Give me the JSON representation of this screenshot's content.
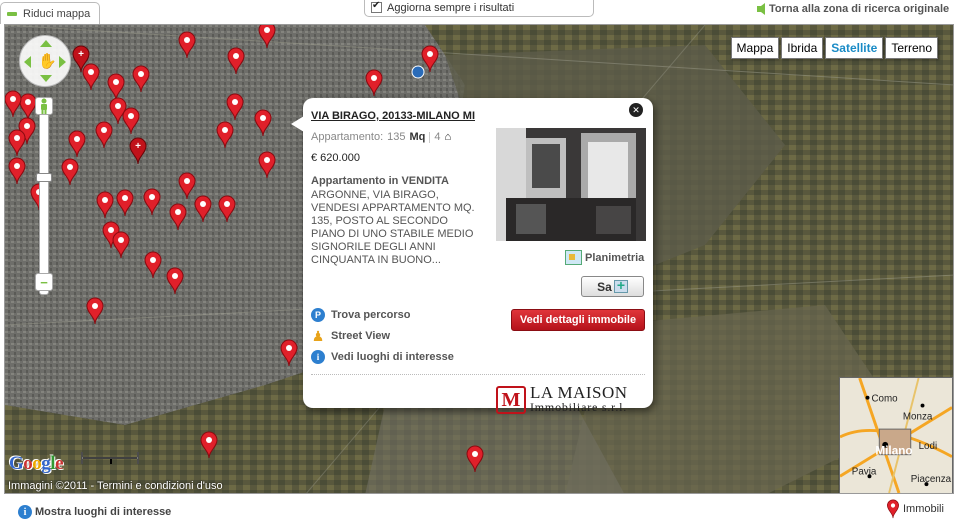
{
  "top": {
    "reduce_label": "Riduci mappa",
    "update_label": "Aggiorna sempre i risultati",
    "update_checked": true,
    "back_label": "Torna alla zona di ricerca originale"
  },
  "map": {
    "types": [
      "Mappa",
      "Ibrida",
      "Satellite",
      "Terreno"
    ],
    "active_type": "Satellite",
    "copyright": "Immagini ©2011 - Termini e condizioni d'uso",
    "google_logo": "Google",
    "overview_labels": [
      "Como",
      "Monza",
      "Milano",
      "Lodi",
      "Pavia",
      "Piacenza"
    ]
  },
  "popup": {
    "address": "VIA BIRAGO, 20133-MILANO MI",
    "type_label": "Appartamento:",
    "size_value": "135",
    "size_unit": "Mq",
    "rooms": "4",
    "price": "€ 620.000",
    "contract": "Appartamento in VENDITA",
    "description": "ARGONNE, VIA BIRAGO, VENDESI APPARTAMENTO MQ. 135, POSTO AL SECONDO PIANO DI UNO STABILE MEDIO SIGNORILE DEGLI ANNI CINQUANTA IN BUONO...",
    "planimetria": "Planimetria",
    "save_label": "Sa",
    "details_label": "Vedi dettagli immobile",
    "actions": [
      "Trova percorso",
      "Street View",
      "Vedi luoghi di interesse"
    ],
    "agency_line1": "LA MAISON",
    "agency_line2": "Immobiliare s.r.l."
  },
  "bottom": {
    "interest_label": "Mostra luoghi di interesse",
    "legend_label": "Immobili"
  },
  "colors": {
    "accent_green": "#7ac043",
    "pin_red": "#e0202a",
    "active_blue": "#1a8bc6",
    "button_red": "#c8171f"
  }
}
